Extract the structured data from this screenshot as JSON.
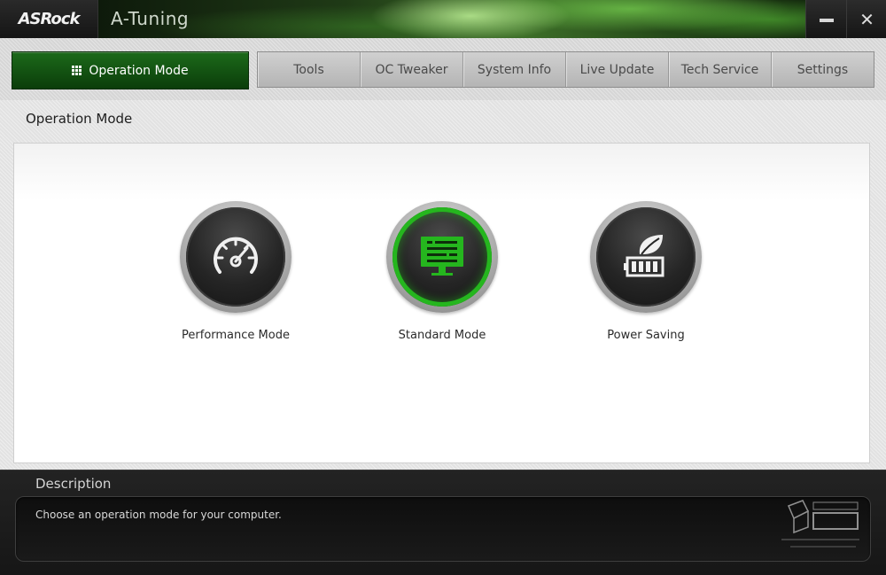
{
  "titlebar": {
    "logo": "ASRock",
    "app_title": "A-Tuning",
    "minimize_icon": "minimize-icon",
    "close_icon": "close-icon"
  },
  "nav": {
    "active": {
      "label": "Operation Mode",
      "icon": "grid-icon"
    },
    "tabs": [
      {
        "label": "Tools"
      },
      {
        "label": "OC Tweaker"
      },
      {
        "label": "System Info"
      },
      {
        "label": "Live Update"
      },
      {
        "label": "Tech Service"
      },
      {
        "label": "Settings"
      }
    ]
  },
  "content": {
    "title": "Operation Mode",
    "modes": [
      {
        "label": "Performance Mode",
        "icon": "speedometer-icon",
        "selected": false
      },
      {
        "label": "Standard Mode",
        "icon": "monitor-icon",
        "selected": true
      },
      {
        "label": "Power Saving",
        "icon": "leaf-battery-icon",
        "selected": false
      }
    ]
  },
  "description": {
    "title": "Description",
    "text": "Choose an operation mode for your computer."
  },
  "colors": {
    "accent_green": "#25b61e",
    "nav_active_bg": "#0f4d0d"
  }
}
